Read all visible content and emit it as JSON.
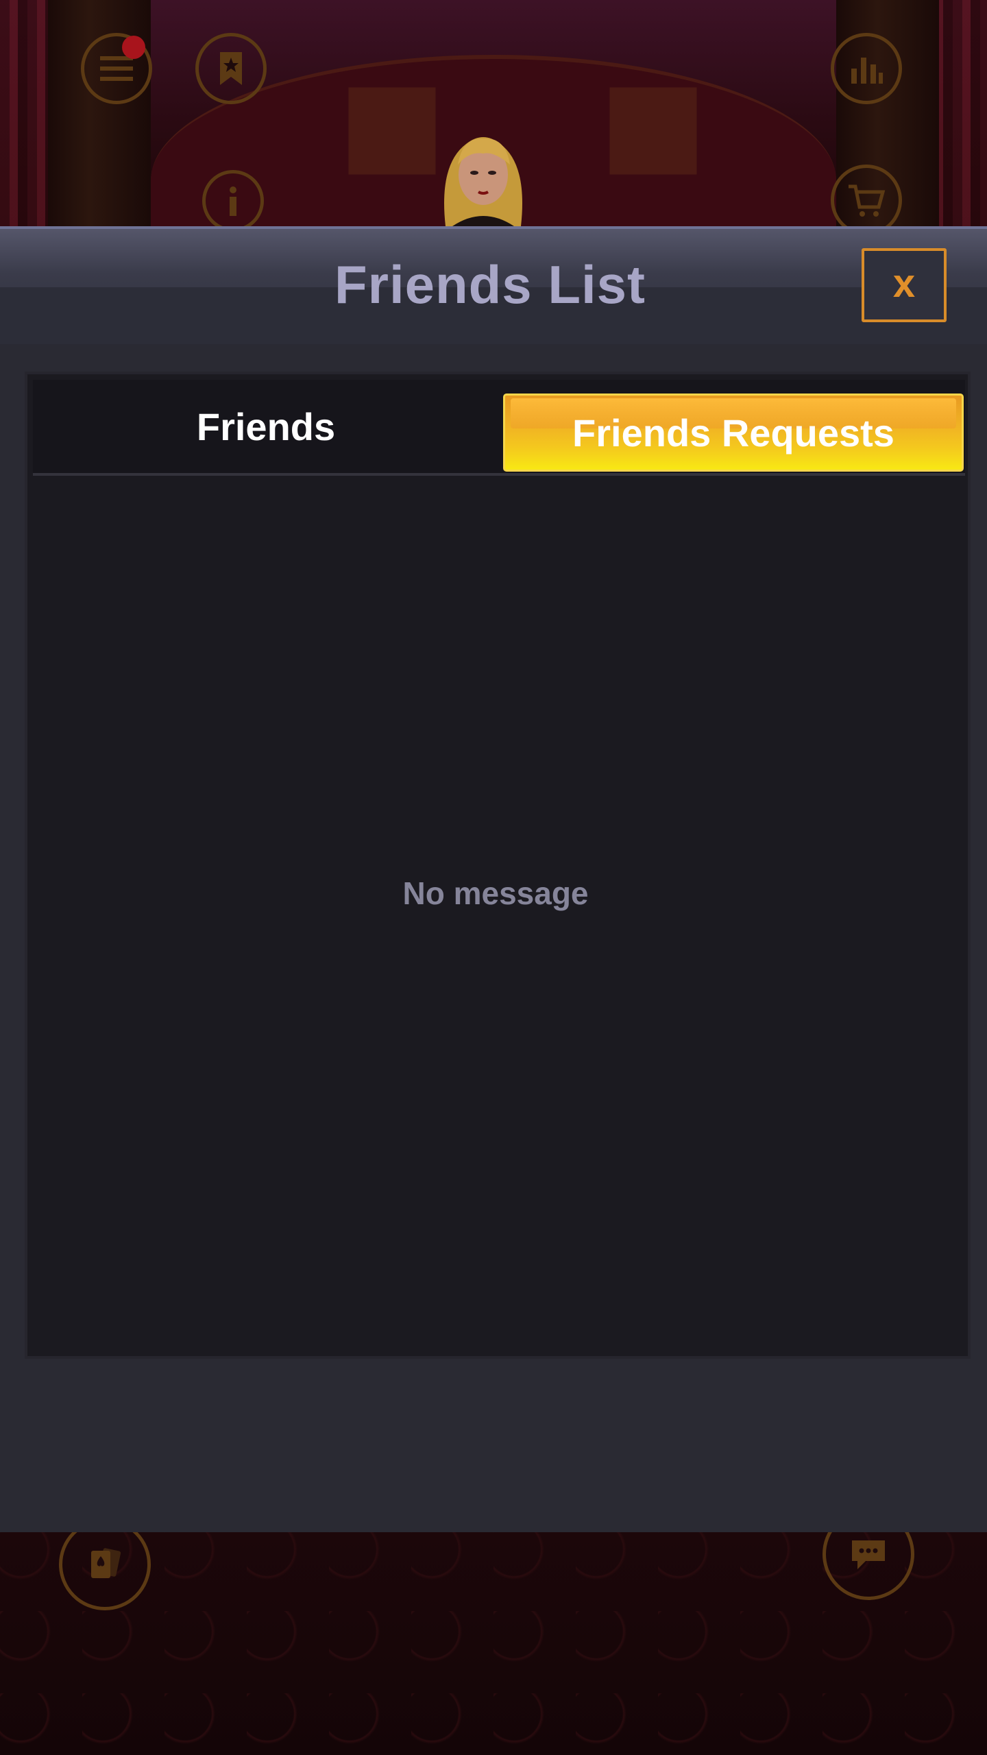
{
  "modal": {
    "title": "Friends List",
    "close_label": "x"
  },
  "tabs": [
    {
      "label": "Friends",
      "selected": false
    },
    {
      "label": "Friends Requests",
      "selected": true
    }
  ],
  "content": {
    "empty_message": "No message"
  },
  "hud": {
    "menu_has_notification": true,
    "icons": [
      "menu-icon",
      "bookmark-star-icon",
      "stats-icon",
      "info-icon",
      "cart-icon",
      "cards-icon",
      "chat-icon"
    ]
  },
  "colors": {
    "accent_gold": "#f4c81e",
    "close_orange": "#e08f2a",
    "title_lavender": "#a8a6c6",
    "empty_text": "#86859a"
  }
}
